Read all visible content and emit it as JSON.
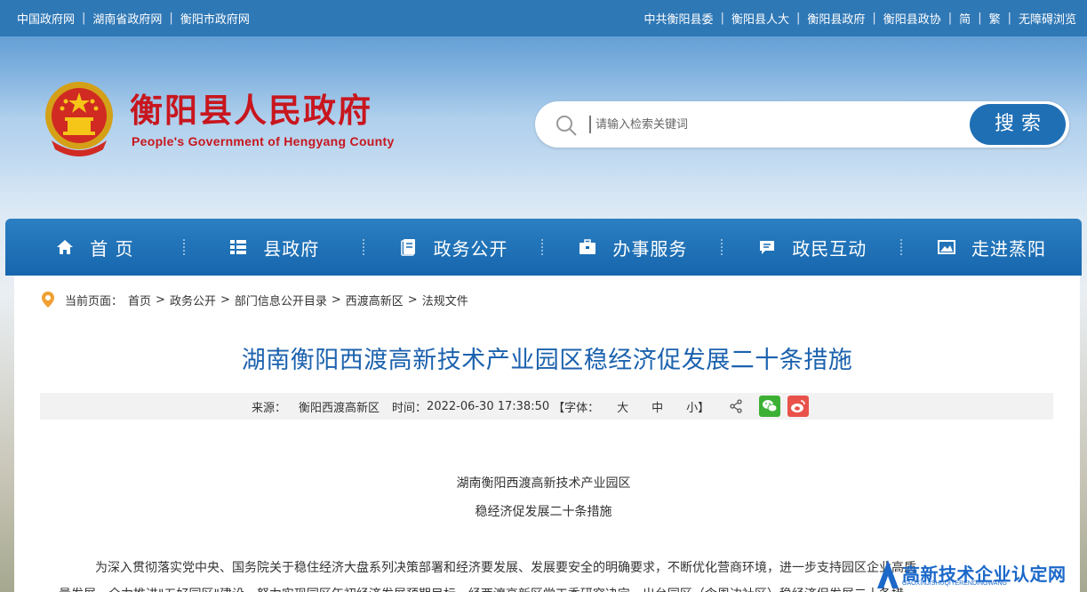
{
  "topbar": {
    "left_links": [
      "中国政府网",
      "湖南省政府网",
      "衡阳市政府网"
    ],
    "right_links": [
      "中共衡阳县委",
      "衡阳县人大",
      "衡阳县政府",
      "衡阳县政协",
      "简",
      "繁",
      "无障碍浏览"
    ]
  },
  "header": {
    "title": "衡阳县人民政府",
    "subtitle": "People's Government of Hengyang County",
    "search_placeholder": "请输入检索关键词",
    "search_button": "搜索"
  },
  "nav": {
    "items": [
      {
        "label": "首 页",
        "icon": "home-icon"
      },
      {
        "label": "县政府",
        "icon": "list-icon"
      },
      {
        "label": "政务公开",
        "icon": "document-icon"
      },
      {
        "label": "办事服务",
        "icon": "briefcase-icon"
      },
      {
        "label": "政民互动",
        "icon": "chat-icon"
      },
      {
        "label": "走进蒸阳",
        "icon": "image-icon"
      }
    ]
  },
  "breadcrumb": {
    "prefix": "当前页面：",
    "items": [
      "首页",
      "政务公开",
      "部门信息公开目录",
      "西渡高新区",
      "法规文件"
    ]
  },
  "article": {
    "title": "湖南衡阳西渡高新技术产业园区稳经济促发展二十条措施",
    "meta": {
      "source_label": "来源：",
      "source": "衡阳西渡高新区",
      "time_label": "时间：",
      "time": "2022-06-30 17:38:50",
      "font_label": "【字体：",
      "font_large": "大",
      "font_medium": "中",
      "font_small": "小】"
    },
    "heading_line1": "湖南衡阳西渡高新技术产业园区",
    "heading_line2": "稳经济促发展二十条措施",
    "paragraph1": "为深入贯彻落实党中央、国务院关于稳住经济大盘系列决策部署和经济要发展、发展要安全的明确要求，不断优化营商环境，进一步支持园区企业高质",
    "paragraph2": "量发展，全力推进\"五好园区\"建设，努力实现园区年初经济发展预期目标，经西渡高新区党工委研究决定，出台园区（含周边社区）稳经济促发展二十条措"
  },
  "watermark": {
    "text": "高新技术企业认定网",
    "sub": "GAOXINJISHUQIYERENDINGWANG"
  },
  "colors": {
    "topbar": "#2f78b6",
    "nav": "#1666ad",
    "title_red": "#c8161e",
    "article_title": "#1c62ae",
    "wechat": "#3cb034",
    "weibo": "#e8524a"
  }
}
